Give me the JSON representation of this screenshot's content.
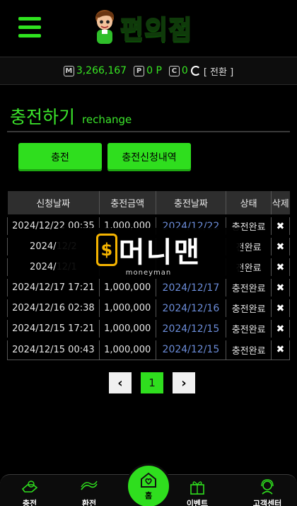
{
  "header": {
    "logo_text": "편의점"
  },
  "balance": {
    "money_icon": "M",
    "money": "3,266,167",
    "point_icon": "P",
    "point": "0 P",
    "comp_icon": "C",
    "comp": "0",
    "switch_label": "[ 전환 ]"
  },
  "page": {
    "title": "충전하기",
    "subtitle": "rechange"
  },
  "buttons": {
    "charge": "충전",
    "history": "충전신청내역"
  },
  "table": {
    "headers": [
      "신청날짜",
      "충전금액",
      "충전날짜",
      "상태",
      "삭제"
    ],
    "rows": [
      {
        "requested": "2024/12/22 00:35",
        "amount": "1,000,000",
        "charged": "2024/12/22",
        "status": "충전완료",
        "delete": "✖"
      },
      {
        "requested": "2024/12/2",
        "amount": "",
        "charged": "",
        "status": "전완료",
        "delete": "✖"
      },
      {
        "requested": "2024/12/1",
        "amount": "",
        "charged": "",
        "status": "전완료",
        "delete": "✖"
      },
      {
        "requested": "2024/12/17 17:21",
        "amount": "1,000,000",
        "charged": "2024/12/17",
        "status": "충전완료",
        "delete": "✖"
      },
      {
        "requested": "2024/12/16 02:38",
        "amount": "1,000,000",
        "charged": "2024/12/16",
        "status": "충전완료",
        "delete": "✖"
      },
      {
        "requested": "2024/12/15 17:21",
        "amount": "1,000,000",
        "charged": "2024/12/15",
        "status": "충전완료",
        "delete": "✖"
      },
      {
        "requested": "2024/12/15 00:43",
        "amount": "1,000,000",
        "charged": "2024/12/15",
        "status": "충전완료",
        "delete": "✖"
      }
    ]
  },
  "watermark": {
    "symbol": "$",
    "text": "머니맨",
    "sub": "moneyman"
  },
  "pagination": {
    "prev": "‹",
    "current": "1",
    "next": "›"
  },
  "bottom_nav": {
    "items": [
      {
        "label": "충전",
        "icon": "charge-icon"
      },
      {
        "label": "환전",
        "icon": "exchange-icon"
      },
      {
        "label": "홈",
        "icon": "home-icon"
      },
      {
        "label": "이벤트",
        "icon": "gift-icon"
      },
      {
        "label": "고객센터",
        "icon": "support-icon"
      }
    ]
  },
  "colors": {
    "accent": "#2fde1e",
    "background": "#000000",
    "link": "#6b8cd8"
  }
}
